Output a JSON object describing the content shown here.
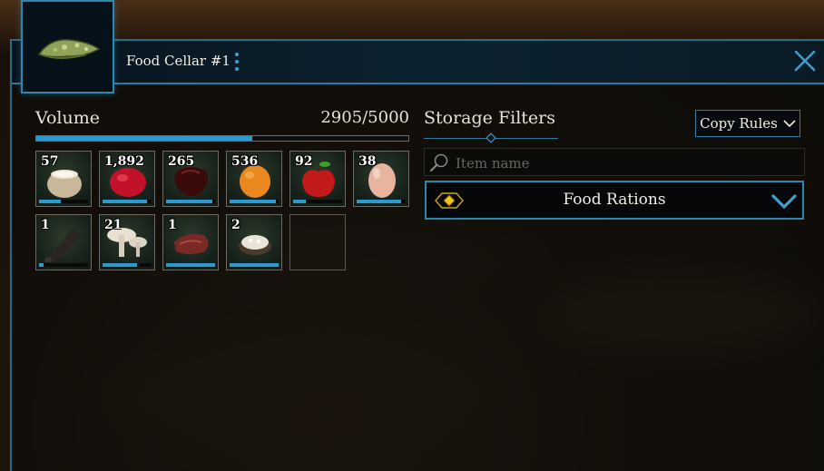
{
  "window": {
    "title": "Food Cellar #1",
    "portrait_icon": "cheese-wedge-icon"
  },
  "volume": {
    "label": "Volume",
    "value_text": "2905/5000",
    "current": 2905,
    "max": 5000
  },
  "inventory": {
    "slots": [
      {
        "qty": "57",
        "icon": "milk-jug-icon",
        "fill": 0.45
      },
      {
        "qty": "1,892",
        "icon": "raspberry-icon",
        "fill": 0.9
      },
      {
        "qty": "265",
        "icon": "dark-meat-icon",
        "fill": 0.95
      },
      {
        "qty": "536",
        "icon": "orange-fruit-icon",
        "fill": 0.95
      },
      {
        "qty": "92",
        "icon": "apple-icon",
        "fill": 0.25
      },
      {
        "qty": "38",
        "icon": "egg-icon",
        "fill": 0.9
      },
      {
        "qty": "1",
        "icon": "drumstick-icon",
        "fill": 0.1
      },
      {
        "qty": "21",
        "icon": "mushroom-icon",
        "fill": 0.7
      },
      {
        "qty": "1",
        "icon": "raw-steak-icon",
        "fill": 1.0
      },
      {
        "qty": "2",
        "icon": "rice-bowl-icon",
        "fill": 1.0
      },
      {
        "qty": "",
        "icon": "",
        "fill": 0
      }
    ]
  },
  "storage_filters": {
    "label": "Storage Filters",
    "copy_rules_label": "Copy Rules",
    "search_placeholder": "Item name",
    "dropdown_value": "Food Rations"
  },
  "colors": {
    "accent": "#2a9ad1",
    "border_blue": "#2f86ad",
    "gem_gold": "#f0c419"
  }
}
